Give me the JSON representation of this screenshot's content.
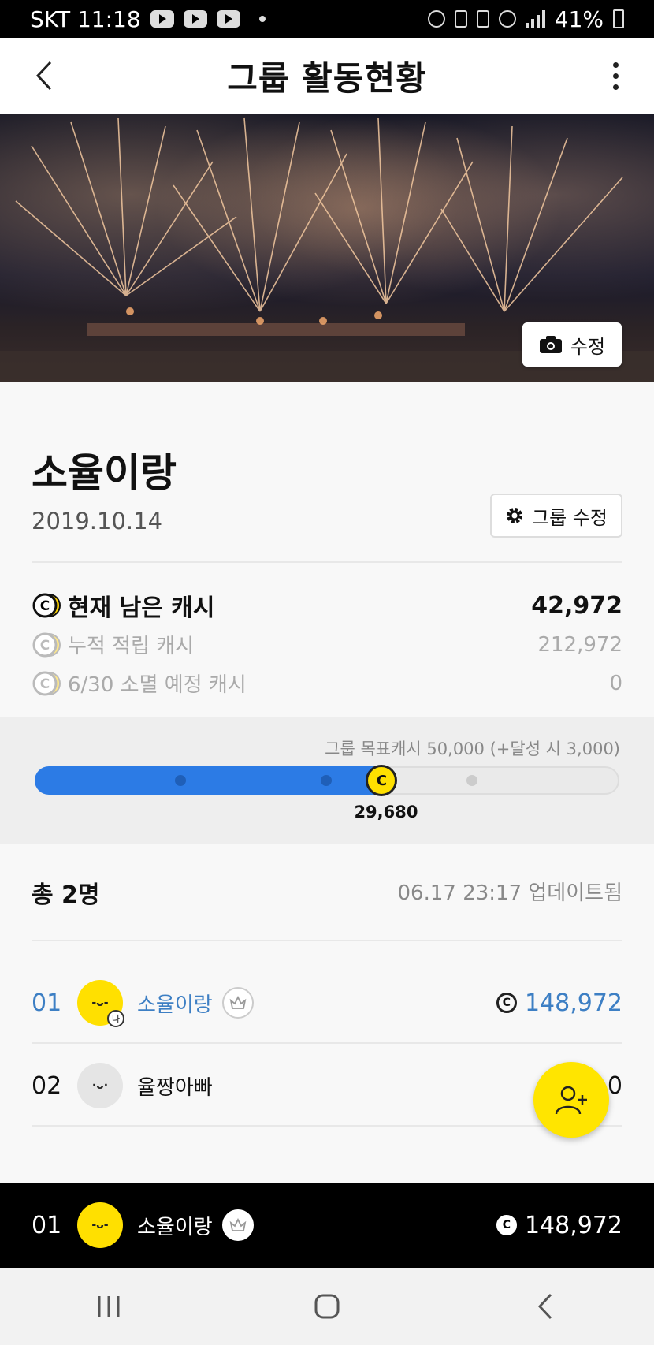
{
  "status_bar": {
    "carrier_time": "SKT 11:18",
    "battery": "41%"
  },
  "header": {
    "title": "그룹 활동현황"
  },
  "cover": {
    "edit_label": "수정"
  },
  "group": {
    "name": "소율이랑",
    "date": "2019.10.14",
    "edit_label": "그룹 수정"
  },
  "cash": {
    "current_label": "현재 남은 캐시",
    "current_value": "42,972",
    "accumulated_label": "누적 적립 캐시",
    "accumulated_value": "212,972",
    "expiring_label": "6/30 소멸 예정 캐시",
    "expiring_value": "0"
  },
  "goal": {
    "label": "그룹 목표캐시 50,000 (+달성 시 3,000)",
    "current_value": "29,680",
    "progress": 0.5936
  },
  "members": {
    "total_label": "총 2명",
    "updated": "06.17 23:17 업데이트됨",
    "list": [
      {
        "rank": "01",
        "name": "소율이랑",
        "cash": "148,972",
        "me_badge": "나"
      },
      {
        "rank": "02",
        "name": "율짱아빠",
        "cash": "0"
      }
    ]
  },
  "my_rank": {
    "rank": "01",
    "name": "소율이랑",
    "cash": "148,972"
  },
  "colors": {
    "accent_blue": "#2c7be5",
    "coin_yellow": "#ffe000",
    "rank_blue": "#3d7fc4"
  }
}
